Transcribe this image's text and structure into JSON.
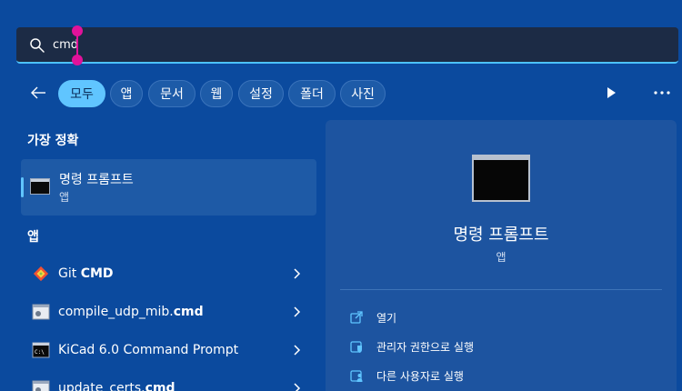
{
  "search": {
    "value": "cmd",
    "placeholder": ""
  },
  "filters": {
    "chips": [
      {
        "label": "모두",
        "active": true
      },
      {
        "label": "앱"
      },
      {
        "label": "문서"
      },
      {
        "label": "웹"
      },
      {
        "label": "설정"
      },
      {
        "label": "폴더"
      },
      {
        "label": "사진"
      }
    ]
  },
  "best_match": {
    "heading": "가장 정확",
    "title": "명령 프롬프트",
    "subtitle": "앱"
  },
  "apps": {
    "heading": "앱",
    "items": [
      {
        "label_normal": "Git ",
        "label_bold": "CMD",
        "icon": "git-icon"
      },
      {
        "label_normal": "compile_udp_mib.",
        "label_bold": "cmd",
        "icon": "script-file-icon"
      },
      {
        "label_normal": "KiCad 6.0 Command Prompt",
        "label_bold": "",
        "icon": "cmd-icon"
      },
      {
        "label_normal": "update_certs.",
        "label_bold": "cmd",
        "icon": "script-file-icon"
      }
    ]
  },
  "details": {
    "title": "명령 프롬프트",
    "subtitle": "앱",
    "actions": [
      {
        "label": "열기",
        "icon": "open-external-icon"
      },
      {
        "label": "관리자 권한으로 실행",
        "icon": "shield-admin-icon"
      },
      {
        "label": "다른 사용자로 실행",
        "icon": "user-switch-icon"
      }
    ]
  },
  "colors": {
    "background": "#0b4a9e",
    "accent": "#60c5ff",
    "search_bg": "#1c2b45",
    "cursor_handle": "#e1129a"
  }
}
